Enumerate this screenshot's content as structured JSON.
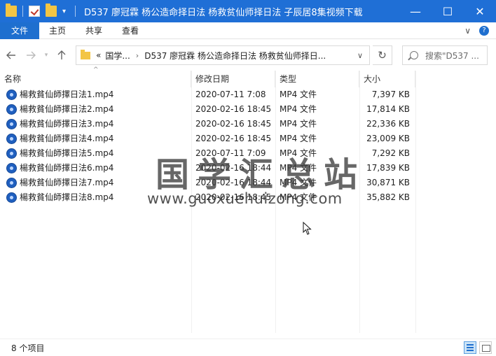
{
  "titlebar": {
    "title": "D537 廖冠霖 杨公造命择日法 杨救贫仙师择日法 子辰居8集视频下载",
    "minimize": "—",
    "maximize": "☐",
    "close": "✕"
  },
  "ribbon": {
    "tabs": [
      "文件",
      "主页",
      "共享",
      "查看"
    ],
    "collapse": "∨",
    "help": "?"
  },
  "address": {
    "crumb_prefix": "«",
    "crumbs": [
      "国学...",
      "D537 廖冠霖 杨公造命择日法 杨救贫仙师择日..."
    ],
    "crumb_sep": "›",
    "search_placeholder": "搜索\"D537 ..."
  },
  "columns": [
    "名称",
    "修改日期",
    "类型",
    "大小"
  ],
  "files": [
    {
      "name": "楊救貧仙師擇日法1.mp4",
      "date": "2020-07-11 7:08",
      "type": "MP4 文件",
      "size": "7,397 KB"
    },
    {
      "name": "楊救貧仙師擇日法2.mp4",
      "date": "2020-02-16 18:45",
      "type": "MP4 文件",
      "size": "17,814 KB"
    },
    {
      "name": "楊救貧仙師擇日法3.mp4",
      "date": "2020-02-16 18:45",
      "type": "MP4 文件",
      "size": "22,336 KB"
    },
    {
      "name": "楊救貧仙師擇日法4.mp4",
      "date": "2020-02-16 18:45",
      "type": "MP4 文件",
      "size": "23,009 KB"
    },
    {
      "name": "楊救貧仙師擇日法5.mp4",
      "date": "2020-07-11 7:09",
      "type": "MP4 文件",
      "size": "7,292 KB"
    },
    {
      "name": "楊救貧仙師擇日法6.mp4",
      "date": "2020-02-16 18:44",
      "type": "MP4 文件",
      "size": "17,839 KB"
    },
    {
      "name": "楊救貧仙師擇日法7.mp4",
      "date": "2020-02-16 18:44",
      "type": "MP4 文件",
      "size": "30,871 KB"
    },
    {
      "name": "楊救貧仙師擇日法8.mp4",
      "date": "2020-02-16 18:45",
      "type": "MP4 文件",
      "size": "35,882 KB"
    }
  ],
  "watermark": {
    "title": "国学汇总站",
    "url": "www.guoxuehuizong.com"
  },
  "status": {
    "item_count": "8 个项目"
  },
  "colors": {
    "titlebar": "#1f6fd6",
    "file_tab": "#1e6fcf"
  }
}
